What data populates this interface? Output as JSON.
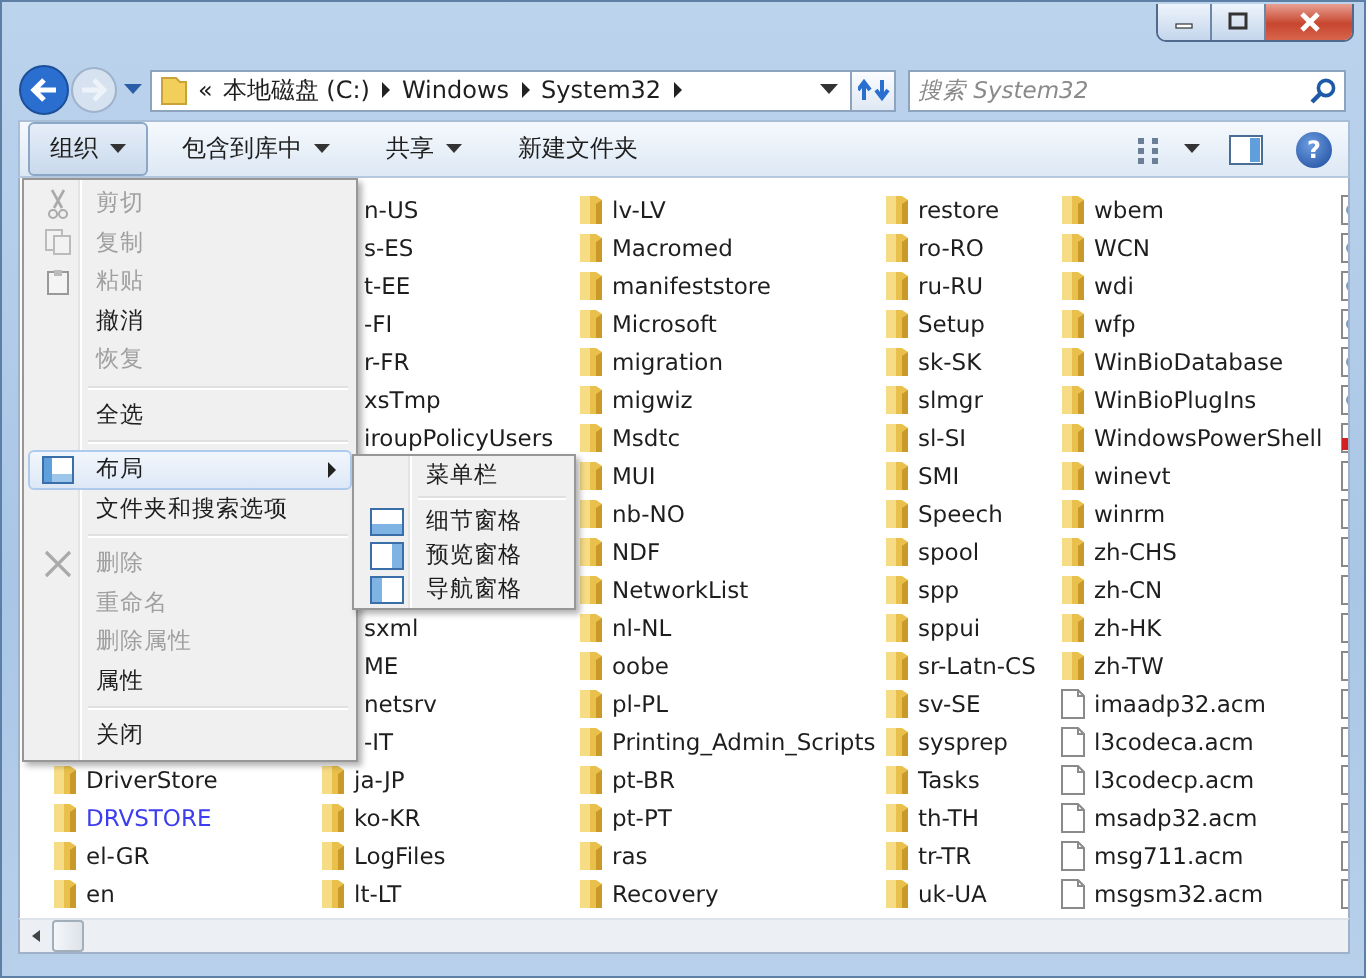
{
  "navigation": {
    "back_enabled": true,
    "forward_enabled": false
  },
  "address_bar": {
    "overflow": "«",
    "path": [
      "本地磁盘 (C:)",
      "Windows",
      "System32"
    ]
  },
  "search": {
    "placeholder": "搜索 System32"
  },
  "toolbar": {
    "buttons": [
      {
        "label": "组织",
        "dropdown": true,
        "selected": true
      },
      {
        "label": "包含到库中",
        "dropdown": true,
        "selected": false
      },
      {
        "label": "共享",
        "dropdown": true,
        "selected": false
      },
      {
        "label": "新建文件夹",
        "dropdown": false,
        "selected": false
      }
    ],
    "help": "?"
  },
  "menu": {
    "items": [
      {
        "kind": "command",
        "label": "剪切",
        "disabled": true,
        "selected": false
      },
      {
        "kind": "command",
        "label": "复制",
        "disabled": true,
        "selected": false
      },
      {
        "kind": "command",
        "label": "粘贴",
        "disabled": true,
        "selected": false
      },
      {
        "kind": "command",
        "label": "撤消",
        "disabled": false,
        "selected": false
      },
      {
        "kind": "command",
        "label": "恢复",
        "disabled": true,
        "selected": false
      },
      {
        "kind": "separator"
      },
      {
        "kind": "command",
        "label": "全选",
        "disabled": false,
        "selected": false
      },
      {
        "kind": "separator"
      },
      {
        "kind": "submenu",
        "label": "布局",
        "disabled": false,
        "selected": true
      },
      {
        "kind": "command",
        "label": "文件夹和搜索选项",
        "disabled": false,
        "selected": false
      },
      {
        "kind": "separator"
      },
      {
        "kind": "command",
        "label": "删除",
        "disabled": true,
        "selected": false
      },
      {
        "kind": "command",
        "label": "重命名",
        "disabled": true,
        "selected": false
      },
      {
        "kind": "command",
        "label": "删除属性",
        "disabled": true,
        "selected": false
      },
      {
        "kind": "command",
        "label": "属性",
        "disabled": false,
        "selected": false
      },
      {
        "kind": "separator"
      },
      {
        "kind": "command",
        "label": "关闭",
        "disabled": false,
        "selected": false
      }
    ]
  },
  "submenu": {
    "items": [
      {
        "kind": "command",
        "label": "菜单栏"
      },
      {
        "kind": "separator"
      },
      {
        "kind": "command",
        "label": "细节窗格"
      },
      {
        "kind": "command",
        "label": "预览窗格"
      },
      {
        "kind": "command",
        "label": "导航窗格"
      }
    ]
  },
  "files": {
    "columns": [
      {
        "groups": [
          [
            {
              "name": "DriverStore",
              "kind": "folder"
            },
            {
              "name": "DRVSTORE",
              "kind": "folder",
              "color": "#3c3cf0"
            },
            {
              "name": "el-GR",
              "kind": "folder"
            },
            {
              "name": "en",
              "kind": "folder"
            }
          ]
        ]
      },
      {
        "groups": [
          [
            {
              "name": "n-US",
              "kind": "clipped"
            },
            {
              "name": "s-ES",
              "kind": "clipped"
            },
            {
              "name": "t-EE",
              "kind": "clipped"
            },
            {
              "name": "-FI",
              "kind": "clipped"
            },
            {
              "name": "r-FR",
              "kind": "clipped"
            },
            {
              "name": "xsTmp",
              "kind": "clipped"
            },
            {
              "name": "iroupPolicyUsers",
              "kind": "clipped"
            }
          ],
          [
            {
              "name": "sxml",
              "kind": "clipped"
            },
            {
              "name": "ME",
              "kind": "clipped"
            },
            {
              "name": "netsrv",
              "kind": "clipped"
            },
            {
              "name": "-IT",
              "kind": "clipped"
            },
            {
              "name": "ja-JP",
              "kind": "folder"
            },
            {
              "name": "ko-KR",
              "kind": "folder"
            },
            {
              "name": "LogFiles",
              "kind": "folder"
            },
            {
              "name": "lt-LT",
              "kind": "folder"
            }
          ]
        ]
      },
      {
        "groups": [
          [
            {
              "name": "lv-LV",
              "kind": "folder"
            },
            {
              "name": "Macromed",
              "kind": "folder"
            },
            {
              "name": "manifeststore",
              "kind": "folder"
            },
            {
              "name": "Microsoft",
              "kind": "folder"
            },
            {
              "name": "migration",
              "kind": "folder"
            },
            {
              "name": "migwiz",
              "kind": "folder"
            },
            {
              "name": "Msdtc",
              "kind": "folder"
            },
            {
              "name": "MUI",
              "kind": "folder"
            },
            {
              "name": "nb-NO",
              "kind": "folder"
            },
            {
              "name": "NDF",
              "kind": "folder"
            },
            {
              "name": "NetworkList",
              "kind": "folder"
            },
            {
              "name": "nl-NL",
              "kind": "folder"
            },
            {
              "name": "oobe",
              "kind": "folder"
            },
            {
              "name": "pl-PL",
              "kind": "folder"
            },
            {
              "name": "Printing_Admin_Scripts",
              "kind": "folder"
            },
            {
              "name": "pt-BR",
              "kind": "folder"
            },
            {
              "name": "pt-PT",
              "kind": "folder"
            },
            {
              "name": "ras",
              "kind": "folder"
            },
            {
              "name": "Recovery",
              "kind": "folder"
            }
          ]
        ]
      },
      {
        "groups": [
          [
            {
              "name": "restore",
              "kind": "folder"
            },
            {
              "name": "ro-RO",
              "kind": "folder"
            },
            {
              "name": "ru-RU",
              "kind": "folder"
            },
            {
              "name": "Setup",
              "kind": "folder"
            },
            {
              "name": "sk-SK",
              "kind": "folder"
            },
            {
              "name": "slmgr",
              "kind": "folder"
            },
            {
              "name": "sl-SI",
              "kind": "folder"
            },
            {
              "name": "SMI",
              "kind": "folder"
            },
            {
              "name": "Speech",
              "kind": "folder"
            },
            {
              "name": "spool",
              "kind": "folder"
            },
            {
              "name": "spp",
              "kind": "folder"
            },
            {
              "name": "sppui",
              "kind": "folder"
            },
            {
              "name": "sr-Latn-CS",
              "kind": "folder"
            },
            {
              "name": "sv-SE",
              "kind": "folder"
            },
            {
              "name": "sysprep",
              "kind": "folder"
            },
            {
              "name": "Tasks",
              "kind": "folder"
            },
            {
              "name": "th-TH",
              "kind": "folder"
            },
            {
              "name": "tr-TR",
              "kind": "folder"
            },
            {
              "name": "uk-UA",
              "kind": "folder"
            }
          ]
        ]
      },
      {
        "groups": [
          [
            {
              "name": "wbem",
              "kind": "folder"
            },
            {
              "name": "WCN",
              "kind": "folder"
            },
            {
              "name": "wdi",
              "kind": "folder"
            },
            {
              "name": "wfp",
              "kind": "folder"
            },
            {
              "name": "WinBioDatabase",
              "kind": "folder"
            },
            {
              "name": "WinBioPlugIns",
              "kind": "folder"
            },
            {
              "name": "WindowsPowerShell",
              "kind": "folder"
            },
            {
              "name": "winevt",
              "kind": "folder"
            },
            {
              "name": "winrm",
              "kind": "folder"
            },
            {
              "name": "zh-CHS",
              "kind": "folder"
            },
            {
              "name": "zh-CN",
              "kind": "folder"
            },
            {
              "name": "zh-HK",
              "kind": "folder"
            },
            {
              "name": "zh-TW",
              "kind": "folder"
            },
            {
              "name": "imaadp32.acm",
              "kind": "file"
            },
            {
              "name": "l3codeca.acm",
              "kind": "file"
            },
            {
              "name": "l3codecp.acm",
              "kind": "file"
            },
            {
              "name": "msadp32.acm",
              "kind": "file"
            },
            {
              "name": "msg711.acm",
              "kind": "file"
            },
            {
              "name": "msgsm32.acm",
              "kind": "file"
            }
          ]
        ]
      },
      {
        "groups": [
          [
            {
              "kind": "settings-file"
            },
            {
              "kind": "settings-file"
            },
            {
              "kind": "settings-file"
            },
            {
              "kind": "settings-file"
            },
            {
              "kind": "settings-file"
            },
            {
              "kind": "settings-file"
            },
            {
              "kind": "red-file"
            },
            {
              "kind": "file"
            },
            {
              "kind": "file"
            },
            {
              "kind": "file"
            },
            {
              "kind": "file"
            },
            {
              "kind": "file"
            },
            {
              "kind": "file"
            },
            {
              "kind": "file"
            },
            {
              "kind": "file"
            },
            {
              "kind": "file"
            },
            {
              "kind": "file"
            },
            {
              "kind": "file"
            },
            {
              "kind": "file"
            }
          ]
        ]
      }
    ]
  }
}
